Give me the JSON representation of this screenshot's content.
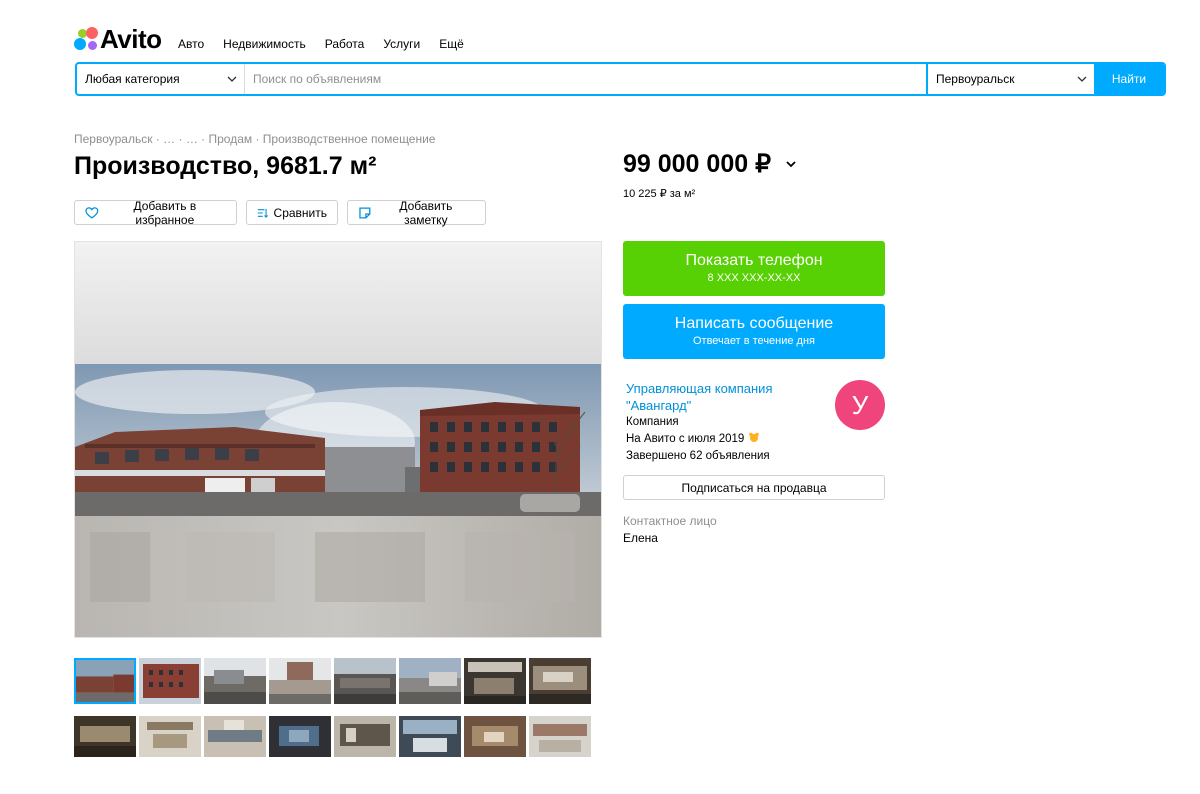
{
  "header": {
    "logo_text": "Avito",
    "nav": [
      "Авто",
      "Недвижимость",
      "Работа",
      "Услуги",
      "Ещё"
    ]
  },
  "search": {
    "category": "Любая категория",
    "placeholder": "Поиск по объявлениям",
    "value": "",
    "city": "Первоуральск",
    "button": "Найти"
  },
  "breadcrumb": {
    "items": [
      "Первоуральск",
      "…",
      "…",
      "Продам",
      "Производственное помещение"
    ],
    "separator": " · "
  },
  "listing": {
    "title": "Производство, 9681.7 м²",
    "price": "99 000 000 ₽",
    "price_per_m2": "10 225 ₽ за м²"
  },
  "actions": {
    "favorite": "Добавить в избранное",
    "compare": "Сравнить",
    "note": "Добавить заметку"
  },
  "gallery": {
    "thumbnail_rows": [
      8,
      8
    ],
    "active_index": 0
  },
  "contact": {
    "phone_label": "Показать телефон",
    "phone_masked": "8 XXX XXX-XX-XX",
    "message_label": "Написать сообщение",
    "message_sub": "Отвечает в течение дня"
  },
  "seller": {
    "name": "Управляющая компания \"Авангард\"",
    "type": "Компания",
    "since": "На Авито с июля 2019",
    "completed": "Завершено 62 объявления",
    "avatar_letter": "У",
    "subscribe": "Подписаться на продавца",
    "contact_label": "Контактное лицо",
    "contact_name": "Елена"
  },
  "colors": {
    "accent": "#00aaff",
    "phone_button": "#57d103",
    "avatar": "#f0457c",
    "link": "#0091d9"
  }
}
